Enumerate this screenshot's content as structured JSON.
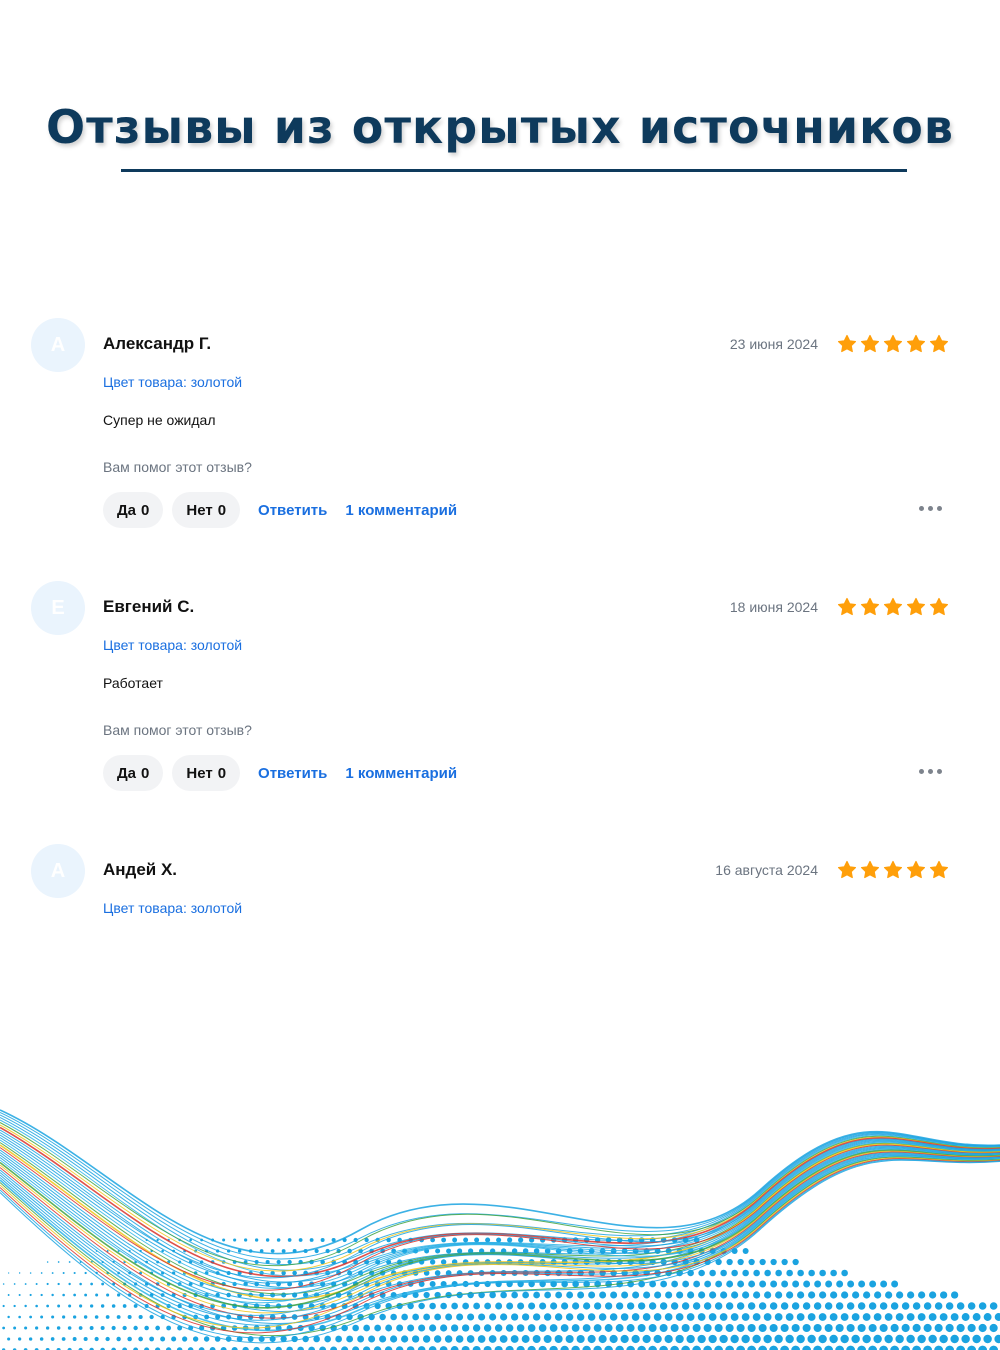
{
  "page": {
    "title": "Отзывы из открытых источников"
  },
  "common": {
    "helpful_question": "Вам помог этот отзыв?",
    "yes_label": "Да",
    "no_label": "Нет",
    "reply_label": "Ответить",
    "star_color": "#ff9f0a",
    "accent_color": "#1a6fe0"
  },
  "reviews": [
    {
      "initial": "А",
      "author": "Александр Г.",
      "date": "23 июня 2024",
      "rating": 5,
      "color_attr": "Цвет товара: золотой",
      "text": "Супер не ожидал",
      "yes_count": "0",
      "no_count": "0",
      "comments": "1 комментарий"
    },
    {
      "initial": "Е",
      "author": "Евгений С.",
      "date": "18 июня 2024",
      "rating": 5,
      "color_attr": "Цвет товара: золотой",
      "text": "Работает",
      "yes_count": "0",
      "no_count": "0",
      "comments": "1 комментарий"
    },
    {
      "initial": "А",
      "author": "Андей Х.",
      "date": "16 августа 2024",
      "rating": 5,
      "color_attr": "Цвет товара: золотой"
    }
  ]
}
